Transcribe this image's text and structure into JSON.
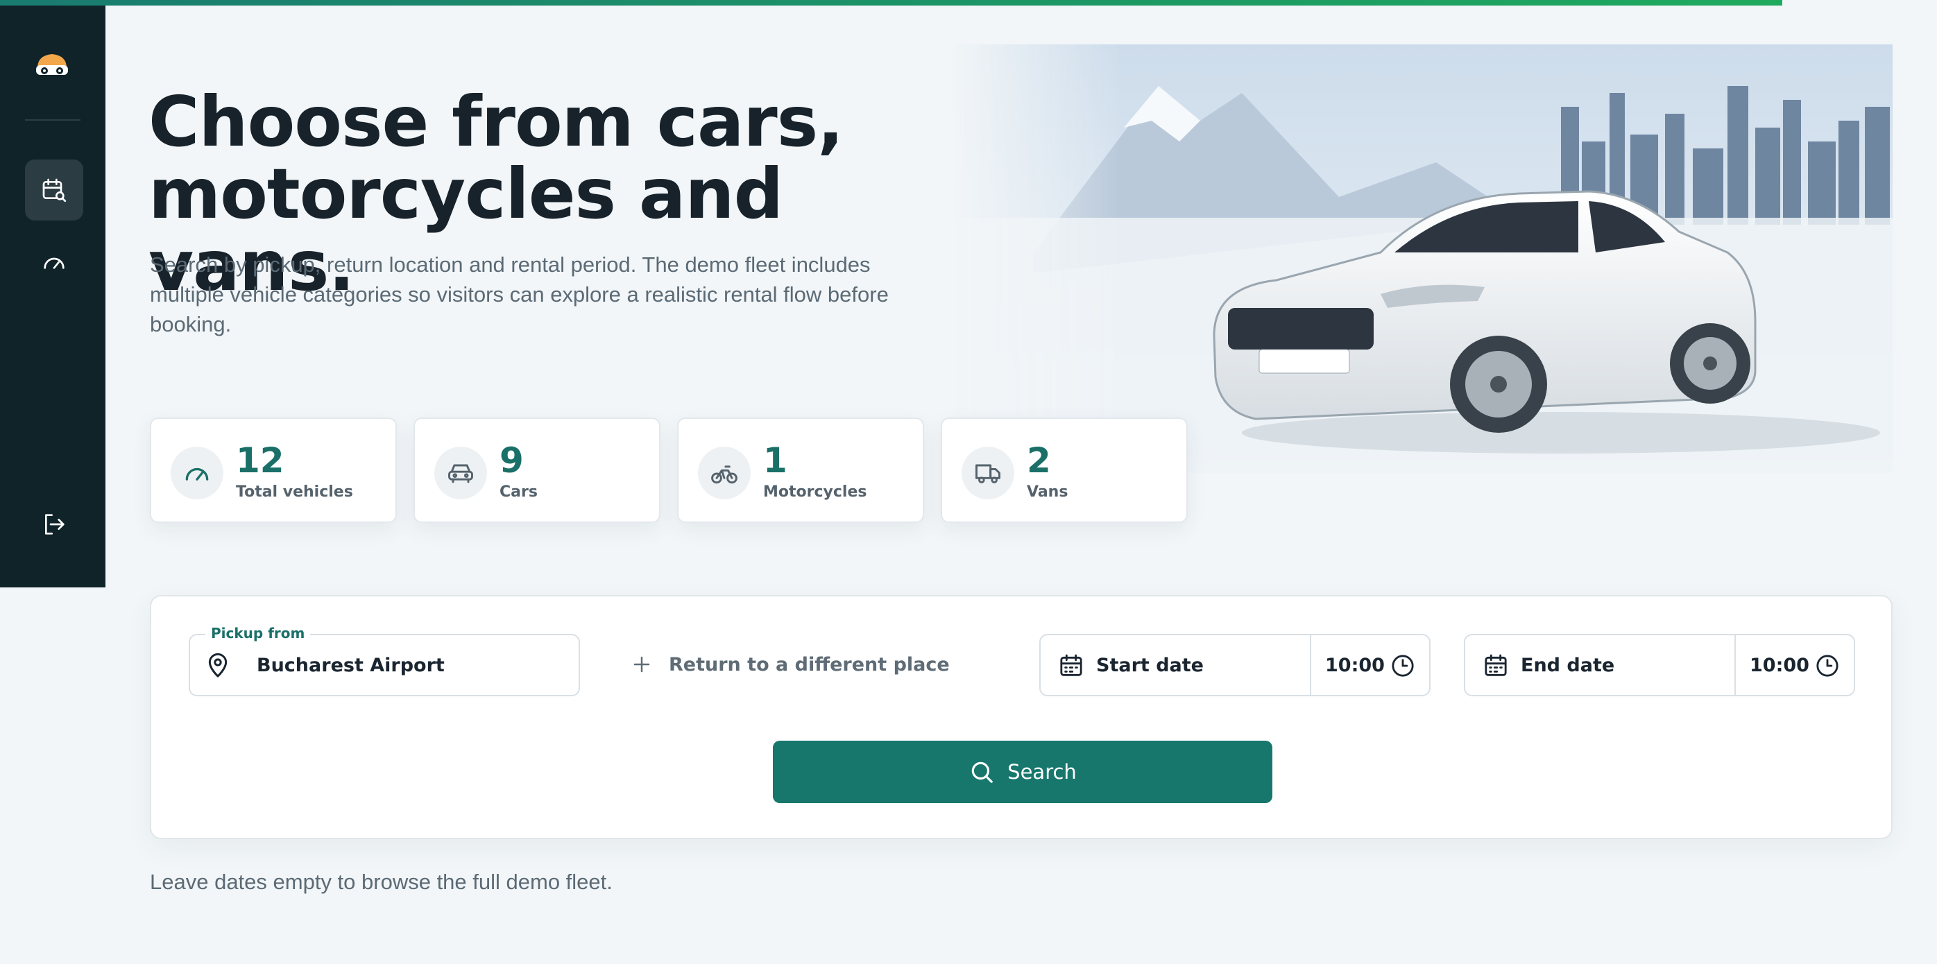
{
  "progress": {
    "percent": 92,
    "color_start": "#1a7b70",
    "color_end": "#1faa5e"
  },
  "sidebar": {
    "logo_icon": "car-logo-icon",
    "items": [
      {
        "icon": "calendar-search-icon",
        "active": true
      },
      {
        "icon": "speedometer-icon",
        "active": false
      },
      {
        "icon": "logout-icon",
        "active": false
      }
    ]
  },
  "hero": {
    "title_line1": "Choose from cars,",
    "title_line2": "motorcycles and vans.",
    "subtitle": "Search by pickup, return location and rental period. The demo fleet includes multiple vehicle categories so visitors can explore a realistic rental flow before booking."
  },
  "stats": [
    {
      "value": "12",
      "label": "Total vehicles",
      "icon": "speedometer-icon"
    },
    {
      "value": "9",
      "label": "Cars",
      "icon": "car-icon"
    },
    {
      "value": "1",
      "label": "Motorcycles",
      "icon": "bicycle-icon"
    },
    {
      "value": "2",
      "label": "Vans",
      "icon": "truck-icon"
    }
  ],
  "search": {
    "pickup_label": "Pickup from",
    "pickup_value": "Bucharest Airport",
    "return_link": "Return to a different place",
    "start_date": "Start date",
    "start_time": "10:00",
    "end_date": "End date",
    "end_time": "10:00",
    "button": "Search"
  },
  "hint": "Leave dates empty to browse the full demo fleet.",
  "colors": {
    "accent": "#17776d",
    "sidebar": "#102329",
    "logo": "#f2a74b"
  }
}
